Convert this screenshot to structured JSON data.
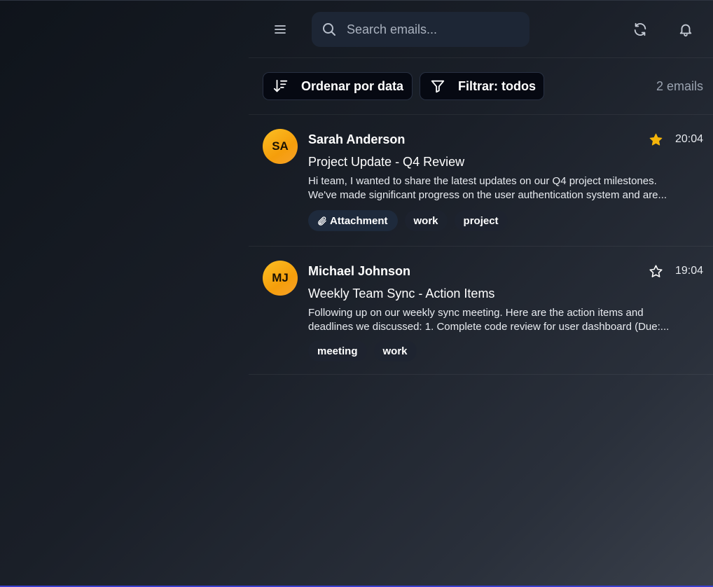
{
  "header": {
    "search_placeholder": "Search emails...",
    "icons": [
      "hamburger-menu-icon",
      "search-icon",
      "refresh-icon",
      "bell-icon"
    ]
  },
  "toolbar": {
    "sort_label": "Ordenar por data",
    "filter_label": "Filtrar: todos",
    "email_count": "2 emails"
  },
  "emails": [
    {
      "initials": "SA",
      "sender": "Sarah Anderson",
      "starred": true,
      "time": "20:04",
      "subject": "Project Update - Q4 Review",
      "preview_line1": "Hi team, I wanted to share the latest updates on our Q4 project milestones.",
      "preview_line2": "We've made significant progress on the user authentication system and are...",
      "attachment_label": "Attachment",
      "tags": [
        "work",
        "project"
      ]
    },
    {
      "initials": "MJ",
      "sender": "Michael Johnson",
      "starred": false,
      "time": "19:04",
      "subject": "Weekly Team Sync - Action Items",
      "preview_line1": "Following up on our weekly sync meeting. Here are the action items and",
      "preview_line2": "deadlines we discussed: 1. Complete code review for user dashboard (Due:...",
      "tags": [
        "meeting",
        "work"
      ]
    }
  ],
  "colors": {
    "avatar": "#fbbf24",
    "star_filled": "#f5b50a",
    "accent_line": "#3b3fd1"
  }
}
